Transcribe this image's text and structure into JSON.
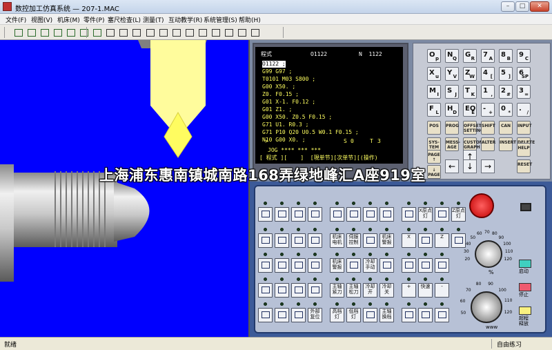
{
  "window": {
    "title": "数控加工仿真系统 — 207-1.MAC",
    "min": "–",
    "max": "□",
    "close": "✕"
  },
  "menu": [
    "文件(F)",
    "视图(V)",
    "机床(M)",
    "零件(P)",
    "塞尺检查(L)",
    "测量(T)",
    "互动教学(R)",
    "系统管理(S)",
    "帮助(H)"
  ],
  "toolbar_icons": [
    "machine-icon",
    "stock-icon",
    "fixture-icon",
    "tool-icon",
    "part-icon",
    "measure-icon",
    "settings-icon",
    "zoom-in-icon",
    "zoom-out-icon",
    "zoom-icon",
    "pan-icon",
    "rotate-icon",
    "view-front-icon",
    "view-top-icon",
    "view-left-icon",
    "view-right-icon",
    "list-icon",
    "swap-icon",
    "display-icon"
  ],
  "cnc_screen": {
    "header_label": "程式",
    "header_program": "O1122",
    "header_seq": "N  1122",
    "lines": [
      "O1122 ;",
      "G99 G97 ;",
      "T0101 M03 S800 ;",
      "G00 X50. ;",
      "Z0. F0.15 ;",
      "G01 X-1. F0.12 ;",
      "G01 Z1. ;",
      "G00 X50. Z0.5 F0.15 ;",
      "G71 U1. R0.3 ;",
      "G71 P10 Q20 U0.5 W0.1 F0.15 ;",
      "N10 G00 X0. ;"
    ],
    "prompt": ">",
    "status_s": "S",
    "status_0": "0",
    "status_t": "T",
    "status_3": "3",
    "mode": "JOG **** *** ***",
    "softkeys": "[ 程式 ][    ]  [現单节][次单节][(操作)"
  },
  "keypad": {
    "alpha": [
      [
        "O",
        "p"
      ],
      [
        "N",
        "Q"
      ],
      [
        "G",
        "R"
      ],
      [
        "7",
        "A"
      ],
      [
        "8",
        "B"
      ],
      [
        "9",
        "C"
      ],
      [
        "X",
        "u"
      ],
      [
        "Y",
        "V"
      ],
      [
        "Z",
        "W"
      ],
      [
        "4",
        "["
      ],
      [
        "5",
        "]"
      ],
      [
        "6",
        "SP"
      ],
      [
        "M",
        "I"
      ],
      [
        "S",
        "J"
      ],
      [
        "T",
        "K"
      ],
      [
        "1",
        ","
      ],
      [
        "2",
        "#"
      ],
      [
        "3",
        "="
      ],
      [
        "F",
        "L"
      ],
      [
        "H",
        "D"
      ],
      [
        "EOB",
        "E"
      ],
      [
        "-",
        "+"
      ],
      [
        "0",
        "*"
      ],
      [
        ".",
        "/"
      ]
    ],
    "func": [
      "POS",
      "PROG",
      "OFFSET SETTING",
      "SHIFT",
      "CAN",
      "INPUT",
      "SYS-TEM",
      "MESS-AGE",
      "CUSTOM GRAPH",
      "ALTER",
      "INSERT",
      "DELETE"
    ],
    "page_up": "PAGE ↑",
    "page_down": "↓ PAGE",
    "help": "HELP",
    "reset": "RESET",
    "arrows": [
      "↑",
      "←",
      "↓",
      "→"
    ]
  },
  "operator": {
    "row1_labels": [
      "",
      "",
      "",
      "",
      "",
      "",
      "",
      "",
      "",
      "X原点灯",
      "",
      "Z原点灯"
    ],
    "row2_labels": [
      "",
      "",
      "",
      "",
      "机床电机",
      "伺服控制",
      "",
      "机床警报",
      "X",
      "",
      "Z",
      ""
    ],
    "row3_labels": [
      "",
      "",
      "",
      "",
      "机床警报",
      "",
      "冷却手动",
      "",
      "",
      "",
      ""
    ],
    "row4_labels": [
      "",
      "",
      "",
      "",
      "主轴紧刀",
      "主轴松刀",
      "冷却开",
      "冷却关",
      "+",
      "快速",
      "-"
    ],
    "row5_labels": [
      "",
      "",
      "",
      "外部复位",
      "高档灯",
      "低档灯",
      "",
      "主轴换档",
      "",
      "",
      ""
    ],
    "start_label": "启动",
    "stop_label": "停止",
    "overtravel_label": "超程释放",
    "feed_ticks": [
      "20",
      "30",
      "40",
      "50",
      "60",
      "70",
      "80",
      "90",
      "100",
      "110",
      "120"
    ],
    "spindle_ticks": [
      "50",
      "60",
      "70",
      "80",
      "90",
      "100",
      "110",
      "120"
    ],
    "percent": "%",
    "wwv": "www"
  },
  "colors": {
    "viewport_bg": "#0000ff",
    "tool": "#fffc9c",
    "part": "#c9c9c9",
    "start": "#40d0c0",
    "stop": "#f05a70",
    "overtravel": "#f8f080"
  },
  "watermark": "上海浦东惠南镇城南路168弄绿地峰汇A座919室",
  "status": {
    "left": "就绪",
    "right": "自由练习"
  }
}
